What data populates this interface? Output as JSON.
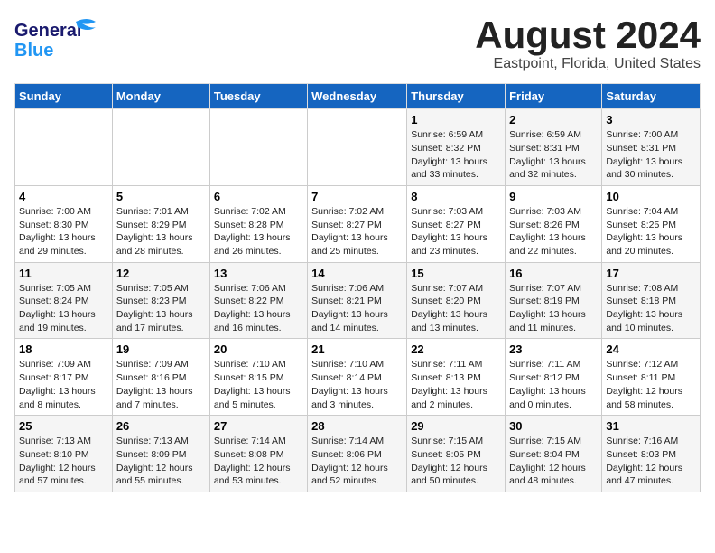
{
  "header": {
    "logo_line1": "General",
    "logo_line2": "Blue",
    "title": "August 2024",
    "subtitle": "Eastpoint, Florida, United States"
  },
  "weekdays": [
    "Sunday",
    "Monday",
    "Tuesday",
    "Wednesday",
    "Thursday",
    "Friday",
    "Saturday"
  ],
  "weeks": [
    [
      {
        "day": "",
        "info": ""
      },
      {
        "day": "",
        "info": ""
      },
      {
        "day": "",
        "info": ""
      },
      {
        "day": "",
        "info": ""
      },
      {
        "day": "1",
        "info": "Sunrise: 6:59 AM\nSunset: 8:32 PM\nDaylight: 13 hours\nand 33 minutes."
      },
      {
        "day": "2",
        "info": "Sunrise: 6:59 AM\nSunset: 8:31 PM\nDaylight: 13 hours\nand 32 minutes."
      },
      {
        "day": "3",
        "info": "Sunrise: 7:00 AM\nSunset: 8:31 PM\nDaylight: 13 hours\nand 30 minutes."
      }
    ],
    [
      {
        "day": "4",
        "info": "Sunrise: 7:00 AM\nSunset: 8:30 PM\nDaylight: 13 hours\nand 29 minutes."
      },
      {
        "day": "5",
        "info": "Sunrise: 7:01 AM\nSunset: 8:29 PM\nDaylight: 13 hours\nand 28 minutes."
      },
      {
        "day": "6",
        "info": "Sunrise: 7:02 AM\nSunset: 8:28 PM\nDaylight: 13 hours\nand 26 minutes."
      },
      {
        "day": "7",
        "info": "Sunrise: 7:02 AM\nSunset: 8:27 PM\nDaylight: 13 hours\nand 25 minutes."
      },
      {
        "day": "8",
        "info": "Sunrise: 7:03 AM\nSunset: 8:27 PM\nDaylight: 13 hours\nand 23 minutes."
      },
      {
        "day": "9",
        "info": "Sunrise: 7:03 AM\nSunset: 8:26 PM\nDaylight: 13 hours\nand 22 minutes."
      },
      {
        "day": "10",
        "info": "Sunrise: 7:04 AM\nSunset: 8:25 PM\nDaylight: 13 hours\nand 20 minutes."
      }
    ],
    [
      {
        "day": "11",
        "info": "Sunrise: 7:05 AM\nSunset: 8:24 PM\nDaylight: 13 hours\nand 19 minutes."
      },
      {
        "day": "12",
        "info": "Sunrise: 7:05 AM\nSunset: 8:23 PM\nDaylight: 13 hours\nand 17 minutes."
      },
      {
        "day": "13",
        "info": "Sunrise: 7:06 AM\nSunset: 8:22 PM\nDaylight: 13 hours\nand 16 minutes."
      },
      {
        "day": "14",
        "info": "Sunrise: 7:06 AM\nSunset: 8:21 PM\nDaylight: 13 hours\nand 14 minutes."
      },
      {
        "day": "15",
        "info": "Sunrise: 7:07 AM\nSunset: 8:20 PM\nDaylight: 13 hours\nand 13 minutes."
      },
      {
        "day": "16",
        "info": "Sunrise: 7:07 AM\nSunset: 8:19 PM\nDaylight: 13 hours\nand 11 minutes."
      },
      {
        "day": "17",
        "info": "Sunrise: 7:08 AM\nSunset: 8:18 PM\nDaylight: 13 hours\nand 10 minutes."
      }
    ],
    [
      {
        "day": "18",
        "info": "Sunrise: 7:09 AM\nSunset: 8:17 PM\nDaylight: 13 hours\nand 8 minutes."
      },
      {
        "day": "19",
        "info": "Sunrise: 7:09 AM\nSunset: 8:16 PM\nDaylight: 13 hours\nand 7 minutes."
      },
      {
        "day": "20",
        "info": "Sunrise: 7:10 AM\nSunset: 8:15 PM\nDaylight: 13 hours\nand 5 minutes."
      },
      {
        "day": "21",
        "info": "Sunrise: 7:10 AM\nSunset: 8:14 PM\nDaylight: 13 hours\nand 3 minutes."
      },
      {
        "day": "22",
        "info": "Sunrise: 7:11 AM\nSunset: 8:13 PM\nDaylight: 13 hours\nand 2 minutes."
      },
      {
        "day": "23",
        "info": "Sunrise: 7:11 AM\nSunset: 8:12 PM\nDaylight: 13 hours\nand 0 minutes."
      },
      {
        "day": "24",
        "info": "Sunrise: 7:12 AM\nSunset: 8:11 PM\nDaylight: 12 hours\nand 58 minutes."
      }
    ],
    [
      {
        "day": "25",
        "info": "Sunrise: 7:13 AM\nSunset: 8:10 PM\nDaylight: 12 hours\nand 57 minutes."
      },
      {
        "day": "26",
        "info": "Sunrise: 7:13 AM\nSunset: 8:09 PM\nDaylight: 12 hours\nand 55 minutes."
      },
      {
        "day": "27",
        "info": "Sunrise: 7:14 AM\nSunset: 8:08 PM\nDaylight: 12 hours\nand 53 minutes."
      },
      {
        "day": "28",
        "info": "Sunrise: 7:14 AM\nSunset: 8:06 PM\nDaylight: 12 hours\nand 52 minutes."
      },
      {
        "day": "29",
        "info": "Sunrise: 7:15 AM\nSunset: 8:05 PM\nDaylight: 12 hours\nand 50 minutes."
      },
      {
        "day": "30",
        "info": "Sunrise: 7:15 AM\nSunset: 8:04 PM\nDaylight: 12 hours\nand 48 minutes."
      },
      {
        "day": "31",
        "info": "Sunrise: 7:16 AM\nSunset: 8:03 PM\nDaylight: 12 hours\nand 47 minutes."
      }
    ]
  ]
}
